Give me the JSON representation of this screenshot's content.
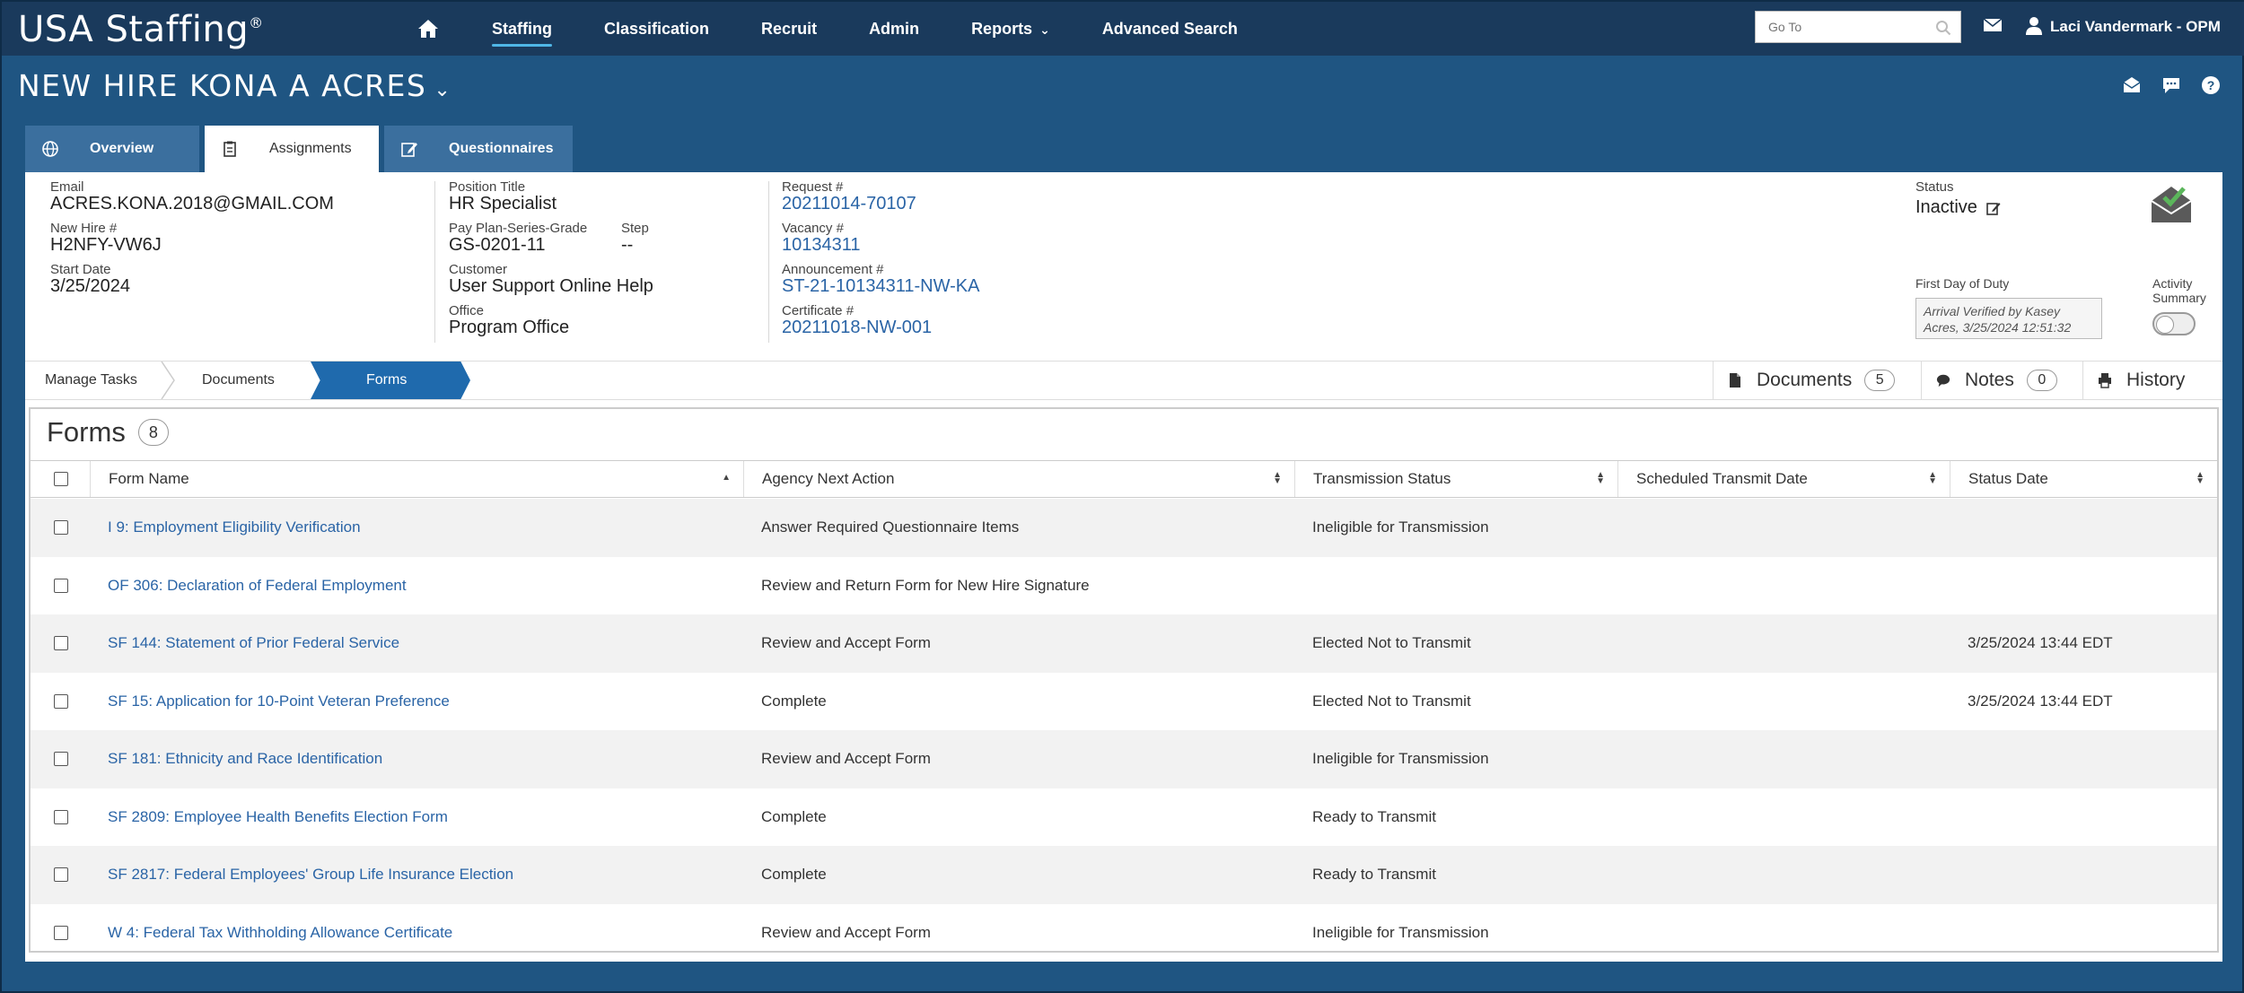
{
  "nav": {
    "brand": "USA Staffing",
    "brand_mark": "®",
    "links": [
      "Staffing",
      "Classification",
      "Recruit",
      "Admin",
      "Reports",
      "Advanced Search"
    ],
    "active_link": "Staffing",
    "goto_placeholder": "Go To",
    "user": "Laci Vandermark - OPM"
  },
  "page": {
    "title": "NEW HIRE KONA A ACRES"
  },
  "tabs": [
    "Overview",
    "Assignments",
    "Questionnaires"
  ],
  "active_tab": "Assignments",
  "details": {
    "email_label": "Email",
    "email": "ACRES.KONA.2018@GMAIL.COM",
    "newhire_label": "New Hire #",
    "newhire": "H2NFY-VW6J",
    "start_label": "Start Date",
    "start": "3/25/2024",
    "position_label": "Position Title",
    "position": "HR Specialist",
    "ppsg_label": "Pay Plan-Series-Grade",
    "ppsg": "GS-0201-11",
    "step_label": "Step",
    "step": "--",
    "customer_label": "Customer",
    "customer": "User Support Online Help",
    "office_label": "Office",
    "office": "Program Office",
    "request_label": "Request #",
    "request": "20211014-70107",
    "vacancy_label": "Vacancy #",
    "vacancy": "10134311",
    "announcement_label": "Announcement #",
    "announcement": "ST-21-10134311-NW-KA",
    "certificate_label": "Certificate #",
    "certificate": "20211018-NW-001",
    "status_label": "Status",
    "status": "Inactive",
    "fdd_label": "First Day of Duty",
    "fdd_value": "Arrival Verified by Kasey Acres, 3/25/2024 12:51:32",
    "activity_label": "Activity Summary",
    "activity_summary_on": false
  },
  "breadcrumb": {
    "items": [
      "Manage Tasks",
      "Documents",
      "Forms"
    ],
    "active": "Forms"
  },
  "right_tabs": {
    "documents_label": "Documents",
    "documents_count": "5",
    "notes_label": "Notes",
    "notes_count": "0",
    "history_label": "History"
  },
  "forms": {
    "heading": "Forms",
    "count": "8",
    "columns": [
      "Form Name",
      "Agency Next Action",
      "Transmission Status",
      "Scheduled Transmit Date",
      "Status Date"
    ],
    "rows": [
      {
        "name": "I 9: Employment Eligibility Verification",
        "action": "Answer Required Questionnaire Items",
        "transmission": "Ineligible for Transmission",
        "scheduled": "",
        "status_date": ""
      },
      {
        "name": "OF 306: Declaration of Federal Employment",
        "action": "Review and Return Form for New Hire Signature",
        "transmission": "",
        "scheduled": "",
        "status_date": ""
      },
      {
        "name": "SF 144: Statement of Prior Federal Service",
        "action": "Review and Accept Form",
        "transmission": "Elected Not to Transmit",
        "scheduled": "",
        "status_date": "3/25/2024 13:44 EDT"
      },
      {
        "name": "SF 15: Application for 10-Point Veteran Preference",
        "action": "Complete",
        "transmission": "Elected Not to Transmit",
        "scheduled": "",
        "status_date": "3/25/2024 13:44 EDT"
      },
      {
        "name": "SF 181: Ethnicity and Race Identification",
        "action": "Review and Accept Form",
        "transmission": "Ineligible for Transmission",
        "scheduled": "",
        "status_date": ""
      },
      {
        "name": "SF 2809: Employee Health Benefits Election Form",
        "action": "Complete",
        "transmission": "Ready to Transmit",
        "scheduled": "",
        "status_date": ""
      },
      {
        "name": "SF 2817: Federal Employees' Group Life Insurance Election",
        "action": "Complete",
        "transmission": "Ready to Transmit",
        "scheduled": "",
        "status_date": ""
      },
      {
        "name": "W 4: Federal Tax Withholding Allowance Certificate",
        "action": "Review and Accept Form",
        "transmission": "Ineligible for Transmission",
        "scheduled": "",
        "status_date": ""
      }
    ]
  },
  "colors": {
    "nav_bg": "#1a3a5c",
    "page_bg": "#1f5582",
    "accent": "#1f6aad",
    "link": "#2a64a6"
  }
}
